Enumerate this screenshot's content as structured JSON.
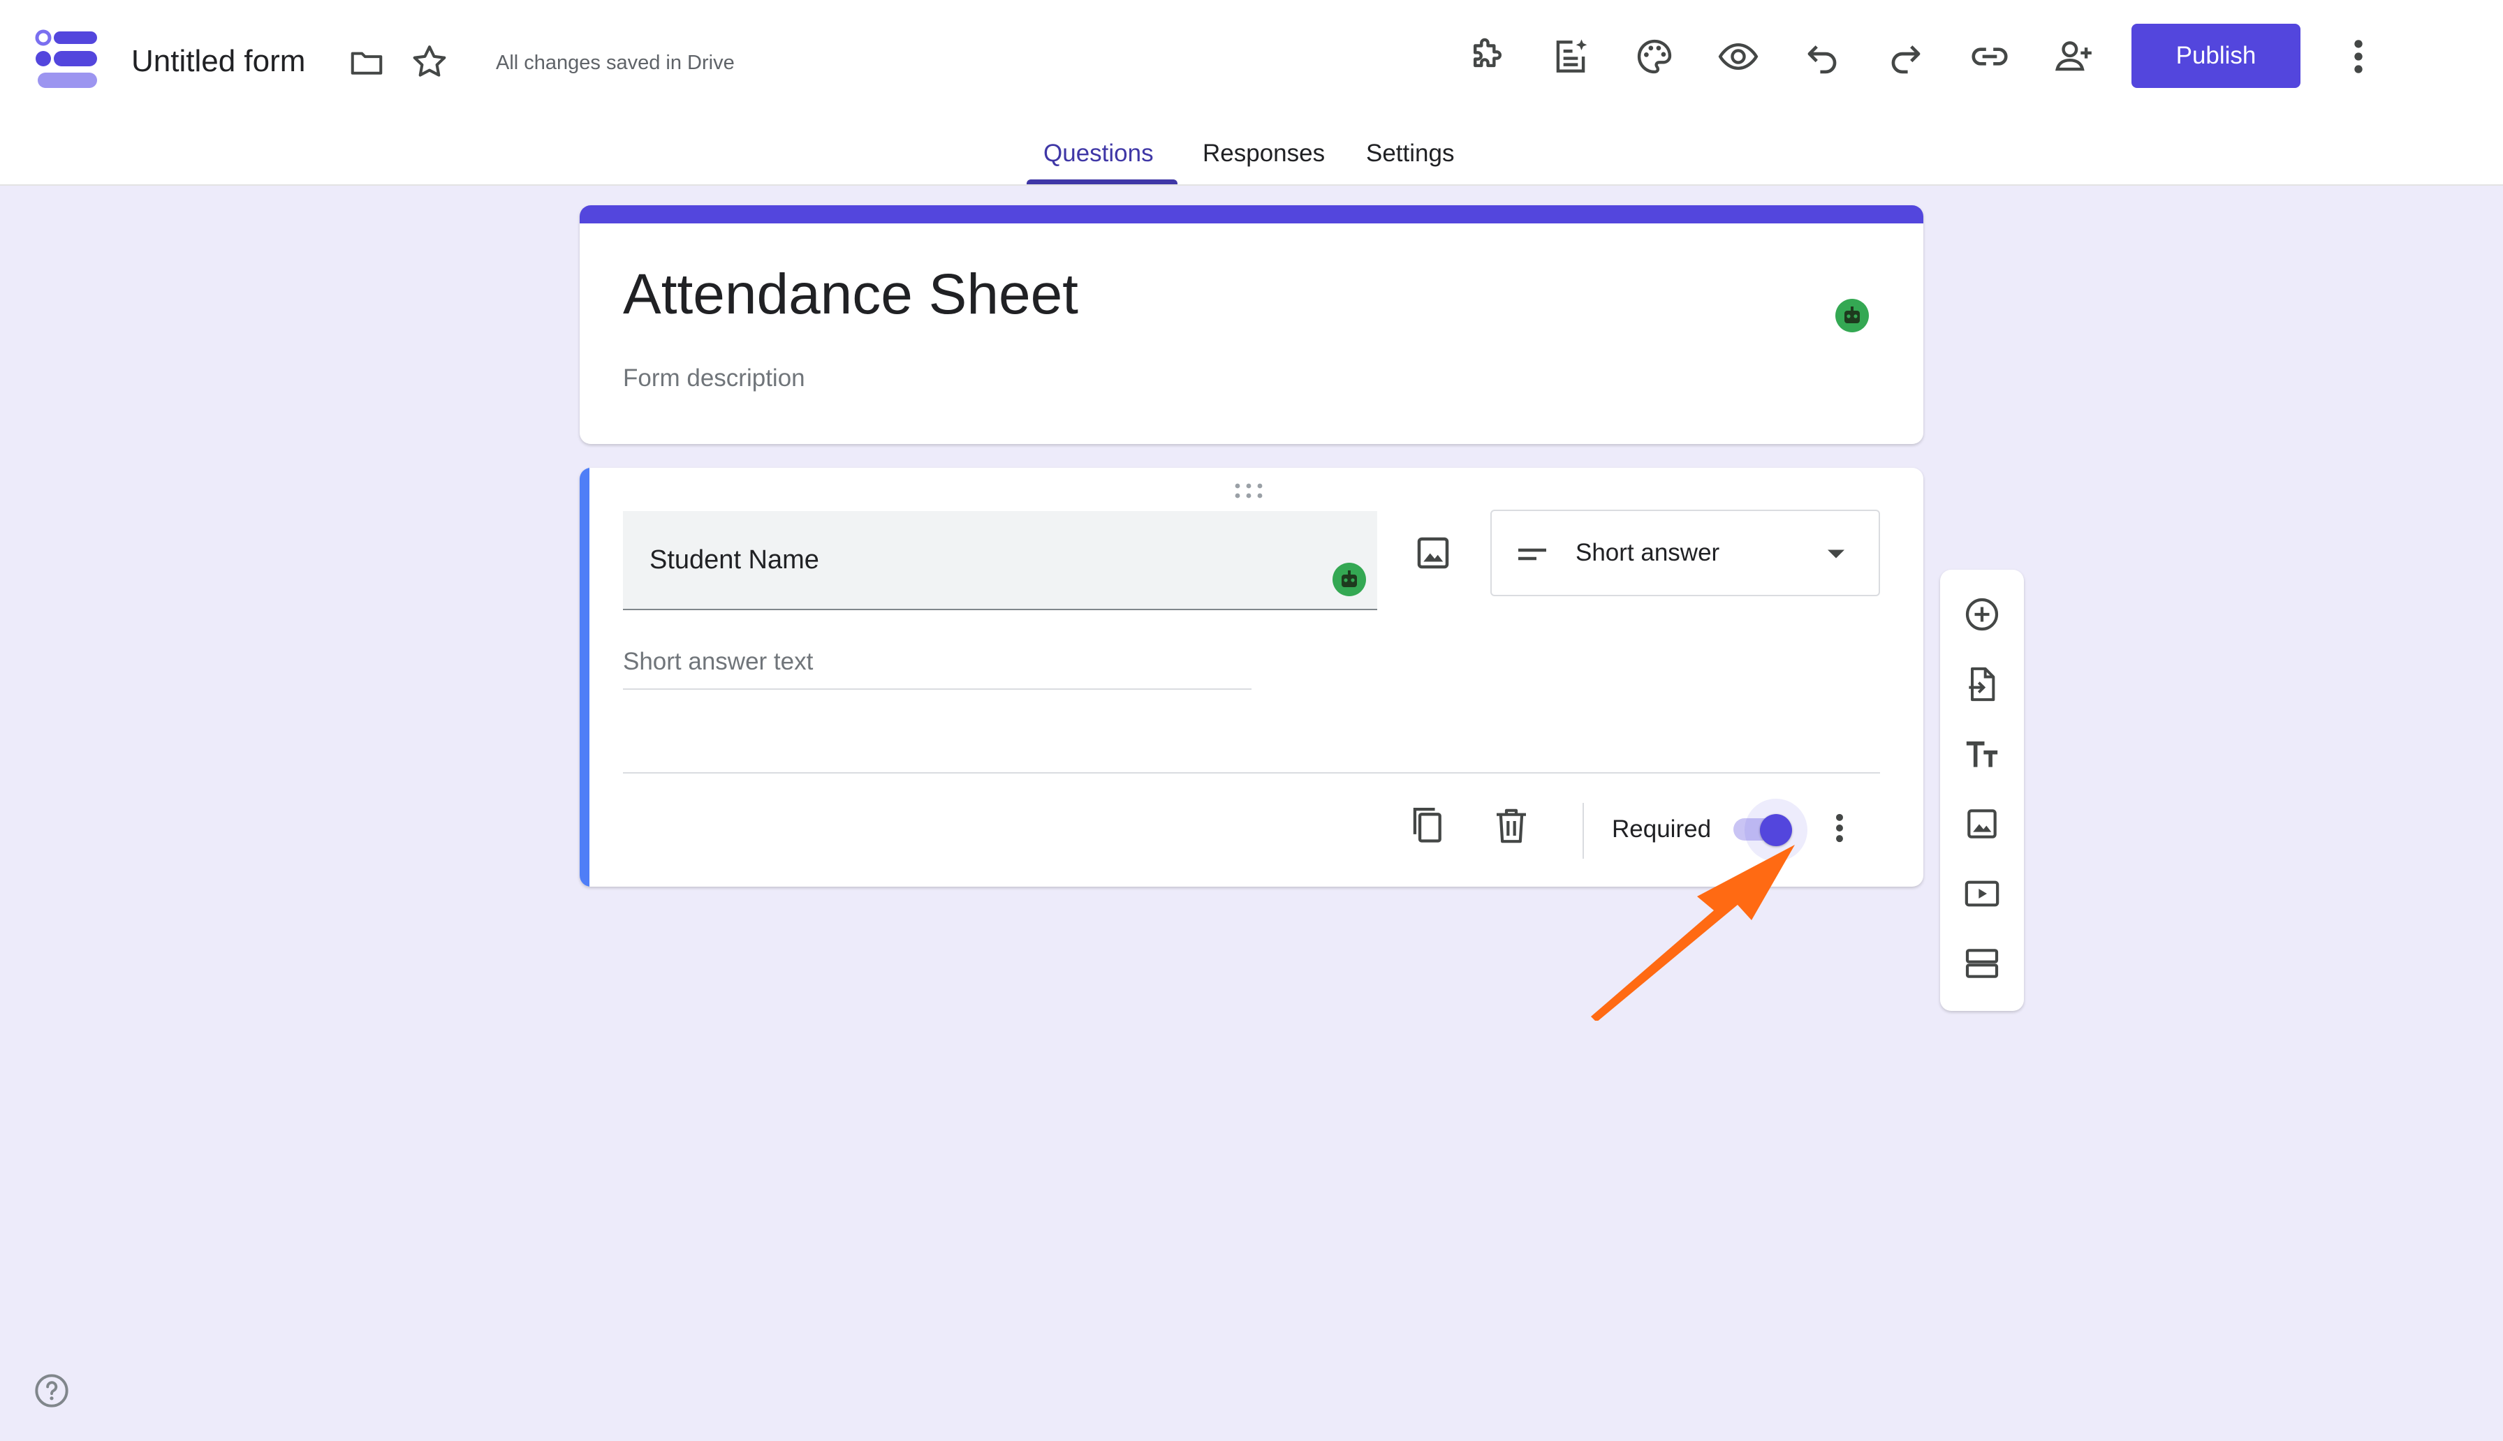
{
  "app": {
    "document_title": "Untitled form",
    "save_status": "All changes saved in Drive",
    "publish_label": "Publish"
  },
  "toolbar_icons": [
    "addons-icon",
    "ai-form-icon",
    "palette-icon",
    "preview-eye-icon",
    "undo-icon",
    "redo-icon",
    "link-icon",
    "add-collaborator-icon",
    "more-vert-icon"
  ],
  "tabs": [
    {
      "label": "Questions",
      "active": true
    },
    {
      "label": "Responses",
      "active": false
    },
    {
      "label": "Settings",
      "active": false
    }
  ],
  "form": {
    "title": "Attendance Sheet",
    "description_placeholder": "Form description"
  },
  "question": {
    "title": "Student Name",
    "type": "Short answer",
    "answer_placeholder": "Short answer text",
    "required_label": "Required",
    "required": true
  },
  "side_toolbar": [
    "add-question-icon",
    "import-questions-icon",
    "add-title-icon",
    "add-image-icon",
    "add-video-icon",
    "add-section-icon"
  ],
  "colors": {
    "accent": "#5346dd",
    "question_accent": "#4f7ef7",
    "background": "#edebfa",
    "annotation_arrow": "#ff6a13"
  }
}
